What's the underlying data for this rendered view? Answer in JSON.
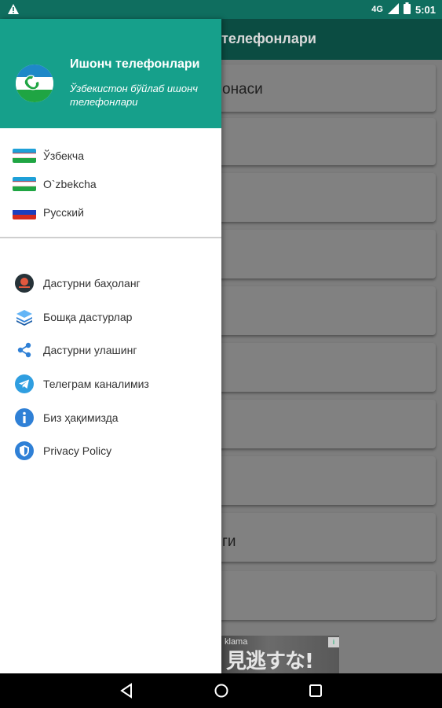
{
  "status_bar": {
    "time": "5:01",
    "network": "4G"
  },
  "app": {
    "title": "телефонлари",
    "cards": [
      {
        "label": "онаси"
      },
      {
        "label": ""
      },
      {
        "label": ""
      },
      {
        "label": ""
      },
      {
        "label": ""
      },
      {
        "label": ""
      },
      {
        "label": ""
      },
      {
        "label": ""
      },
      {
        "label": "ги"
      },
      {
        "label": ""
      }
    ],
    "ad": {
      "label": "klama",
      "badge": "i",
      "text": "見逃すな!"
    }
  },
  "drawer": {
    "title": "Ишонч телефонлари",
    "subtitle": "Ўзбекистон бўйлаб ишонч телефонлари",
    "languages": [
      {
        "label": "Ўзбекча",
        "flag": "uzbekistan"
      },
      {
        "label": "O`zbekcha",
        "flag": "uzbekistan"
      },
      {
        "label": "Русский",
        "flag": "russia"
      }
    ],
    "items": [
      {
        "label": "Дастурни баҳоланг",
        "icon": "rate-icon"
      },
      {
        "label": "Бошқа дастурлар",
        "icon": "layers-icon"
      },
      {
        "label": "Дастурни улашинг",
        "icon": "share-icon"
      },
      {
        "label": "Телеграм каналимиз",
        "icon": "telegram-icon"
      },
      {
        "label": "Биз ҳақимизда",
        "icon": "info-icon"
      },
      {
        "label": "Privacy Policy",
        "icon": "shield-icon"
      }
    ]
  },
  "colors": {
    "header": "#16a08b",
    "status_bar": "#0f6e5f",
    "toolbar": "#0b4c42",
    "icon_blue": "#2f80d6"
  }
}
